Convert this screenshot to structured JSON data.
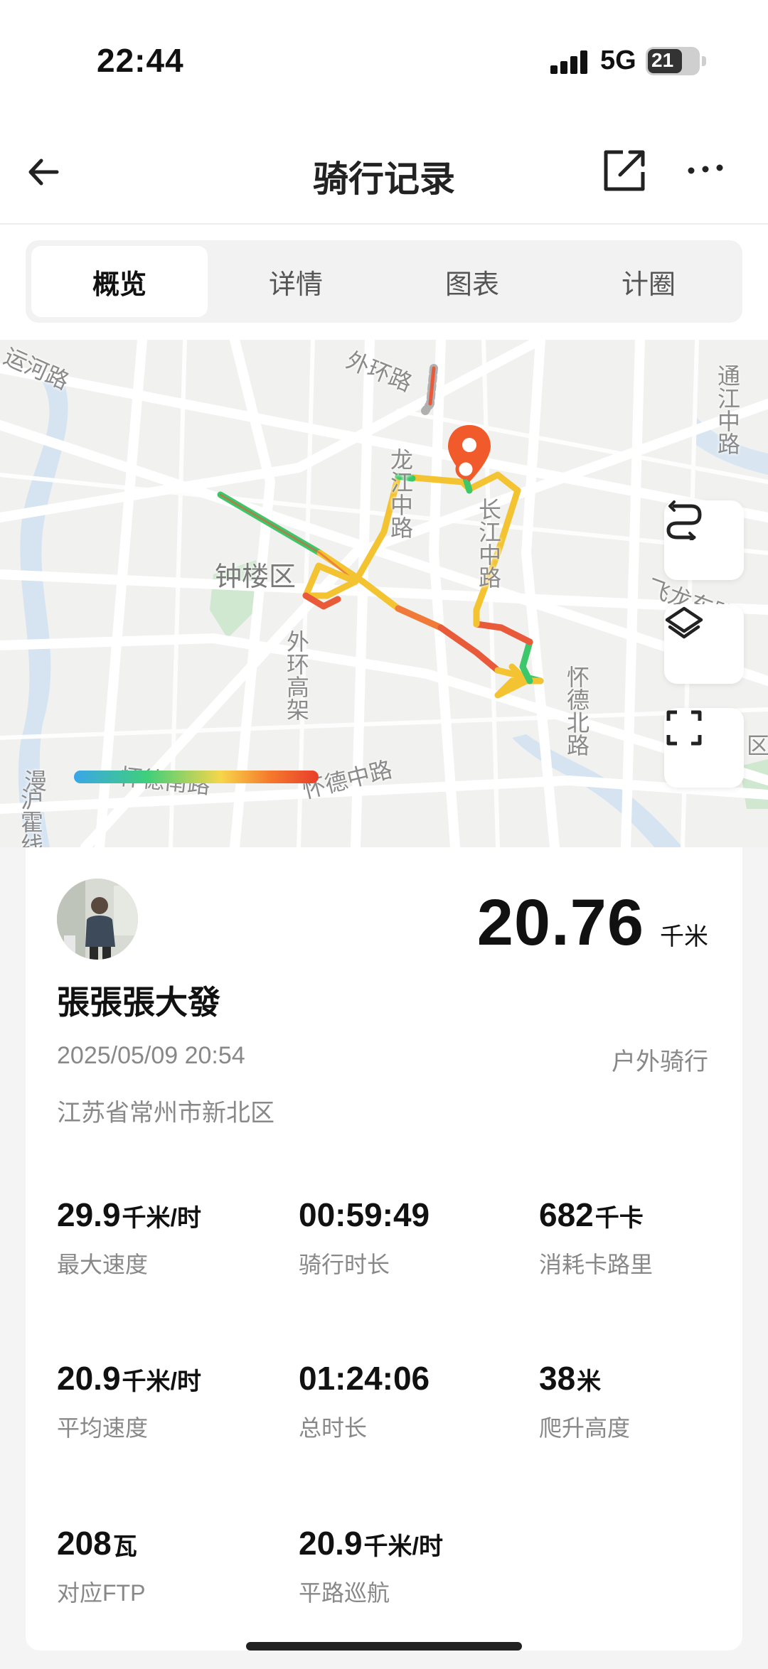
{
  "status_bar": {
    "time": "22:44",
    "network": "5G",
    "battery": "21"
  },
  "nav": {
    "title": "骑行记录"
  },
  "tabs": [
    {
      "label": "概览",
      "active": true
    },
    {
      "label": "详情",
      "active": false
    },
    {
      "label": "图表",
      "active": false
    },
    {
      "label": "计圈",
      "active": false
    }
  ],
  "map": {
    "labels": {
      "yunhe": "运河路",
      "waihuan": "外环路",
      "tongjiang": "通江中路",
      "longjiang": "龙江中路",
      "changjiang": "长江中路",
      "zhonglou": "钟楼区",
      "feilong": "飞龙东路",
      "waihuan_gaojia": "外环高架",
      "huaide_bei": "怀德北路",
      "huaide_nan": "怀德南路",
      "huaide_zhong": "怀德中路",
      "man": "漫",
      "huhuo": "沪霍线",
      "quan": "区"
    },
    "legend_colors": [
      "#3aa6e8",
      "#3fcf7a",
      "#f6d64a",
      "#f57a2c",
      "#e83d2a"
    ]
  },
  "summary": {
    "distance_value": "20.76",
    "distance_unit": "千米",
    "username": "張張張大發",
    "datetime": "2025/05/09 20:54",
    "ride_type": "户外骑行",
    "location": "江苏省常州市新北区"
  },
  "stats": {
    "max_speed": {
      "value": "29.9",
      "unit": "千米/时",
      "label": "最大速度"
    },
    "ride_duration": {
      "value": "00:59:49",
      "unit": "",
      "label": "骑行时长"
    },
    "calories": {
      "value": "682",
      "unit": "千卡",
      "label": "消耗卡路里"
    },
    "avg_speed": {
      "value": "20.9",
      "unit": "千米/时",
      "label": "平均速度"
    },
    "total_duration": {
      "value": "01:24:06",
      "unit": "",
      "label": "总时长"
    },
    "elevation": {
      "value": "38",
      "unit": "米",
      "label": "爬升高度"
    },
    "ftp": {
      "value": "208",
      "unit": "瓦",
      "label": "对应FTP"
    },
    "flat_cruise": {
      "value": "20.9",
      "unit": "千米/时",
      "label": "平路巡航"
    }
  }
}
